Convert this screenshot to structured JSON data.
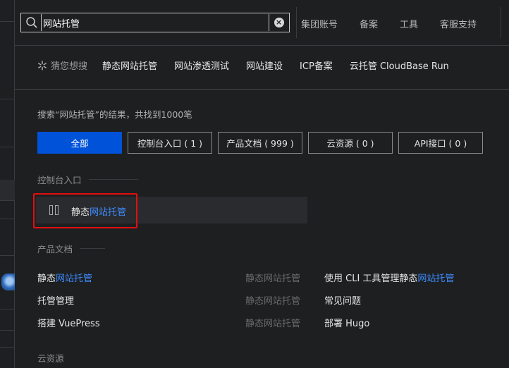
{
  "search": {
    "query": "网站托管",
    "clear_symbol": "×"
  },
  "topnav": {
    "items": [
      "集团账号",
      "备案",
      "工具",
      "客服支持"
    ]
  },
  "guess": {
    "label": "猜您想搜",
    "items": [
      "静态网站托管",
      "网站渗透测试",
      "网站建设",
      "ICP备案",
      "云托管 CloudBase Run"
    ]
  },
  "results": {
    "summary": "搜索“网站托管”的结果，共找到1000笔",
    "filters": [
      {
        "label": "全部",
        "active": true
      },
      {
        "label": "控制台入口 ( 1 )",
        "active": false
      },
      {
        "label": "产品文档 ( 999 )",
        "active": false
      },
      {
        "label": "云资源 ( 0 )",
        "active": false
      },
      {
        "label": "API接口 ( 0 )",
        "active": false
      }
    ]
  },
  "console": {
    "title": "控制台入口",
    "entry": {
      "prefix": "静态",
      "highlight": "网站托管"
    }
  },
  "docs": {
    "title": "产品文档",
    "rows": [
      {
        "c1_prefix": "静态",
        "c1_highlight": "网站托管",
        "c2": "静态网站托管",
        "c3_prefix": "使用 CLI 工具管理静态",
        "c3_highlight": "网站托管"
      },
      {
        "c1_prefix": "托管管理",
        "c1_highlight": "",
        "c2": "静态网站托管",
        "c3_prefix": "常见问题",
        "c3_highlight": ""
      },
      {
        "c1_prefix": "搭建 VuePress",
        "c1_highlight": "",
        "c2": "静态网站托管",
        "c3_prefix": "部署 Hugo",
        "c3_highlight": ""
      }
    ]
  },
  "cloud": {
    "title": "云资源"
  },
  "colors": {
    "accent": "#0052d9",
    "highlight": "#3d8bff",
    "annotation": "#e30f0f"
  }
}
